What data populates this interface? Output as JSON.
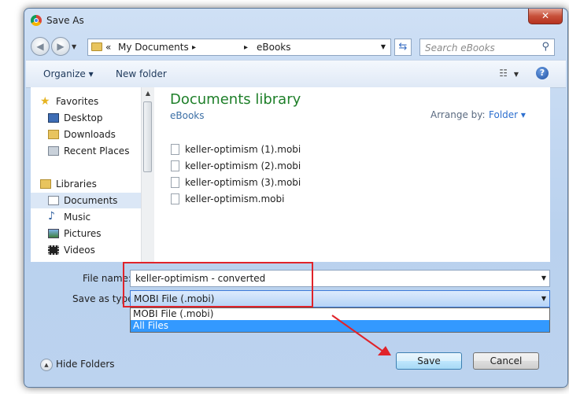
{
  "window": {
    "title": "Save As",
    "close_glyph": "✕"
  },
  "navigation": {
    "address_segments": [
      "«",
      "My Documents",
      "▸",
      "▸",
      "eBooks"
    ],
    "search_placeholder": "Search eBooks"
  },
  "toolbar": {
    "organize_label": "Organize ▾",
    "new_folder_label": "New folder"
  },
  "nav_pane": {
    "favorites": {
      "label": "Favorites",
      "items": [
        "Desktop",
        "Downloads",
        "Recent Places"
      ]
    },
    "libraries": {
      "label": "Libraries",
      "items": [
        "Documents",
        "Music",
        "Pictures",
        "Videos"
      ]
    },
    "selected": "Documents"
  },
  "content": {
    "library_title": "Documents library",
    "library_subtitle": "eBooks",
    "arrange_by_label": "Arrange by:",
    "arrange_by_value": "Folder ▾",
    "files": [
      "keller-optimism (1).mobi",
      "keller-optimism (2).mobi",
      "keller-optimism (3).mobi",
      "keller-optimism.mobi"
    ]
  },
  "form": {
    "file_name_label": "File name:",
    "file_name_value": "keller-optimism - converted",
    "save_as_type_label": "Save as type:",
    "save_as_type_value": "MOBI File (.mobi)",
    "type_options": [
      "MOBI File (.mobi)",
      "All Files"
    ],
    "selected_option": "All Files"
  },
  "footer": {
    "hide_folders_label": "Hide Folders",
    "save_label": "Save",
    "cancel_label": "Cancel"
  },
  "colors": {
    "annotation_red": "#e0232a",
    "library_green": "#1e7f29",
    "selection_blue": "#3399ff"
  }
}
